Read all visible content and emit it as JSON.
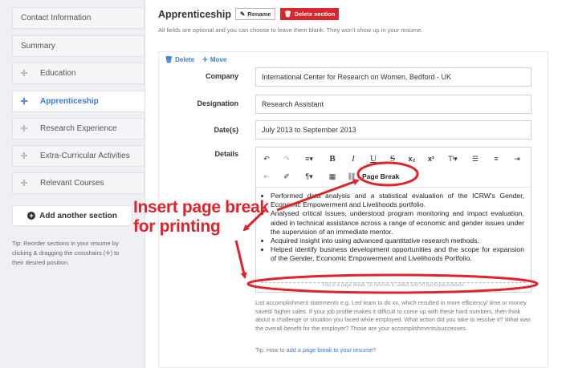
{
  "sidebar": {
    "items": [
      {
        "label": "Contact Information",
        "draggable": false,
        "active": false
      },
      {
        "label": "Summary",
        "draggable": false,
        "active": false
      },
      {
        "label": "Education",
        "draggable": true,
        "active": false
      },
      {
        "label": "Apprenticeship",
        "draggable": true,
        "active": true
      },
      {
        "label": "Research Experience",
        "draggable": true,
        "active": false
      },
      {
        "label": "Extra-Curricular Activities",
        "draggable": true,
        "active": false
      },
      {
        "label": "Relevant Courses",
        "draggable": true,
        "active": false
      }
    ],
    "add_label": "Add another section",
    "tip": "Tip: Reorder sections in your resume by clicking & dragging the crosshairs (✛) to their desired position."
  },
  "section": {
    "title": "Apprenticeship",
    "rename_label": "Rename",
    "delete_label": "Delete section",
    "subtitle": "All fields are optional and you can choose to leave them blank. They won't show up in your resume."
  },
  "card": {
    "delete_label": "Delete",
    "move_label": "Move",
    "fields": {
      "company": {
        "label": "Company",
        "value": "International Center for Research on Women, Bedford - UK"
      },
      "designation": {
        "label": "Designation",
        "value": "Research Assistant"
      },
      "dates": {
        "label": "Date(s)",
        "value": "July 2013 to September 2013"
      },
      "details": {
        "label": "Details"
      }
    }
  },
  "editor": {
    "toolbar_row1": [
      "↶",
      "↷",
      "≡▾",
      "B",
      "I",
      "U",
      "S",
      "x₂",
      "x²",
      "Tᴵ▾",
      "☰",
      "≡",
      "⇥"
    ],
    "toolbar_row2": [
      "⇤",
      "✐",
      "¶▾",
      "▦",
      "⛓"
    ],
    "page_break_label": "Page Break",
    "bullets": [
      "Performed data analysis and a statistical evaluation of the ICRW's Gender, Economic Empowerment and Livelihoods portfolio.",
      "Analysed critical issues, understood program monitoring and impact evaluation, aided in technical assistance across a range of economic and gender issues under the supervision of an immediate mentor.",
      "Acquired insight into using advanced quantitative research methods.",
      "Helped identify business development opportunities and the scope for expansion of the Gender, Economic Empowerment and Livelihoods Portfolio."
    ],
    "page_break_text": "This is a page break. To remove it, select and hit backspace/delete."
  },
  "hint": "List accomplishment statements e.g. Led team to do xx, which resulted in more efficiency/ time or money saved/ higher sales. If your job profile makes it difficult to come up with these hard numbers, then think about a challenge or situation you faced while employed. What action did you take to resolve it? What was the overall benefit for the employer? Those are your accomplishments/successes.",
  "tip2": {
    "prefix": "Tip: How to ",
    "link": "add a page break to your resume?"
  },
  "annotation": {
    "line1": "Insert page break",
    "line2": "for printing"
  },
  "colors": {
    "accent": "#3a7bd5",
    "danger": "#d9262c",
    "annotation": "#e0232b"
  }
}
